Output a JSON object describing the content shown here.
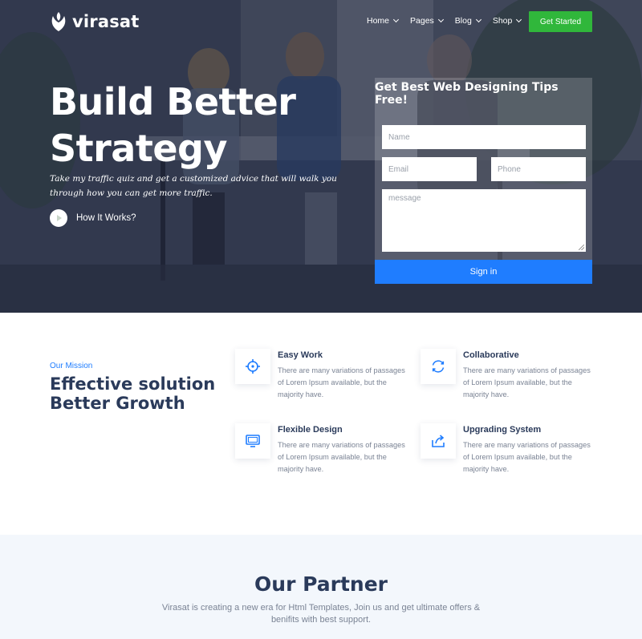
{
  "header": {
    "brand": "virasat",
    "nav": [
      {
        "label": "Home"
      },
      {
        "label": "Pages"
      },
      {
        "label": "Blog"
      },
      {
        "label": "Shop"
      }
    ],
    "cta_label": "Get Started"
  },
  "hero": {
    "title": "Build Better Strategy",
    "subtitle": "Take my traffic quiz and get a customized advice that will walk you through how you can get more traffic.",
    "how_label": "How It Works?"
  },
  "form": {
    "title": "Get Best Web Designing Tips Free!",
    "name_placeholder": "Name",
    "email_placeholder": "Email",
    "phone_placeholder": "Phone",
    "message_placeholder": "message",
    "submit_label": "Sign in"
  },
  "mission": {
    "eyebrow": "Our Mission",
    "title": "Effective solution Better Growth",
    "features": [
      {
        "title": "Easy Work",
        "desc": "There are many variations of passages of Lorem Ipsum available, but the majority have.",
        "icon": "crosshair-icon"
      },
      {
        "title": "Collaborative",
        "desc": "There are many variations of passages of Lorem Ipsum available, but the majority have.",
        "icon": "refresh-icon"
      },
      {
        "title": "Flexible Design",
        "desc": "There are many variations of passages of Lorem Ipsum available, but the majority have.",
        "icon": "monitor-icon"
      },
      {
        "title": "Upgrading System",
        "desc": "There are many variations of passages of Lorem Ipsum available, but the majority have.",
        "icon": "share-icon"
      }
    ]
  },
  "partner": {
    "title": "Our Partner",
    "desc": "Virasat is creating a new era for Html Templates, Join us and get ultimate offers & benifits with best support."
  },
  "colors": {
    "accent_blue": "#1f7dff",
    "cta_green": "#30b73b",
    "heading_navy": "#2a3a5a",
    "partner_bg": "#f3f7fc"
  }
}
